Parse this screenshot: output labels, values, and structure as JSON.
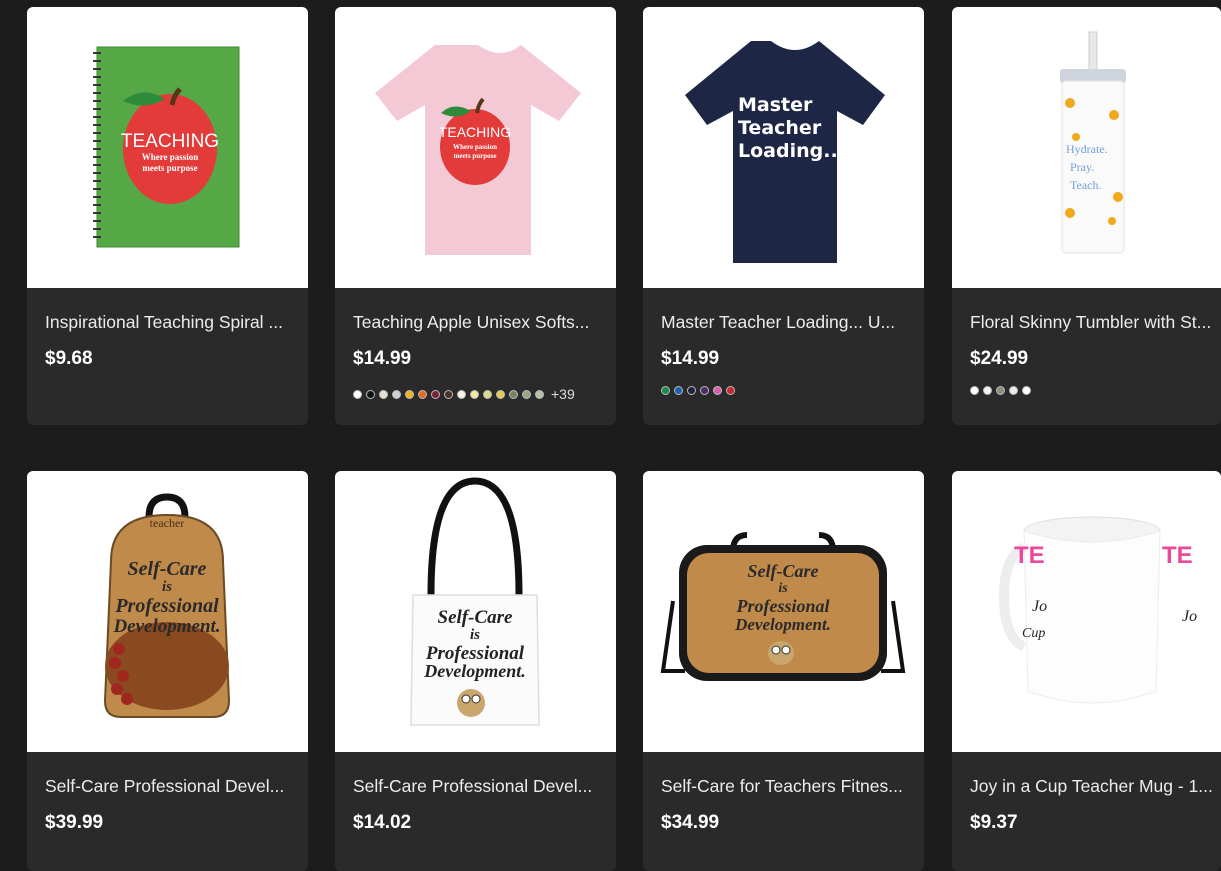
{
  "products": [
    {
      "title": "Inspirational Teaching Spiral ...",
      "price": "$9.68",
      "swatches": [],
      "more": ""
    },
    {
      "title": "Teaching Apple Unisex Softs...",
      "price": "$14.99",
      "swatches": [
        "#ffffff",
        "#111111",
        "#e9e1cf",
        "#cfcfcf",
        "#f3b21b",
        "#e36a21",
        "#7a2436",
        "#4a3428",
        "#fbf5e8",
        "#f4e89b",
        "#d9d98c",
        "#e6c94a",
        "#75845f",
        "#9aa587",
        "#b7c1a8"
      ],
      "more": "+39"
    },
    {
      "title": "Master Teacher Loading... U...",
      "price": "$14.99",
      "swatches": [
        "#1b8a4a",
        "#1e5fb3",
        "#1d2544",
        "#4a2a6b",
        "#d85fb0",
        "#c8272d"
      ],
      "more": ""
    },
    {
      "title": "Floral Skinny Tumbler with St...",
      "price": "$24.99",
      "swatches": [
        "#ffffff",
        "#f4f4f4",
        "#8b8f78",
        "#ececec",
        "#ffffff"
      ],
      "more": ""
    },
    {
      "title": "Self-Care Professional Devel...",
      "price": "$39.99",
      "swatches": [],
      "more": ""
    },
    {
      "title": "Self-Care Professional Devel...",
      "price": "$14.02",
      "swatches": [],
      "more": ""
    },
    {
      "title": "Self-Care for Teachers Fitnes...",
      "price": "$34.99",
      "swatches": [],
      "more": ""
    },
    {
      "title": "Joy in a Cup Teacher Mug - 1...",
      "price": "$9.37",
      "swatches": [],
      "more": ""
    }
  ],
  "art": {
    "notebook": {
      "word": "TEACHING",
      "line1": "Where passion",
      "line2": "meets purpose"
    },
    "tshirt_apple": {
      "word": "TEACHING",
      "line1": "Where passion",
      "line2": "meets purpose"
    },
    "tshirt_navy": {
      "line1": "Master",
      "line2": "Teacher",
      "line3": "Loading..."
    },
    "tumbler": {
      "line1": "Hydrate.",
      "line2": "Pray.",
      "line3": "Teach."
    },
    "backpack": {
      "top": "teacher",
      "line1": "Self-Care",
      "line2": "is",
      "line3": "Professional",
      "line4": "Development."
    },
    "tote": {
      "line1": "Self-Care",
      "line2": "is",
      "line3": "Professional",
      "line4": "Development."
    },
    "duffel": {
      "line1": "Self-Care",
      "line2": "is",
      "line3": "Professional",
      "line4": "Development."
    },
    "mug": {
      "line1": "TE",
      "line2": "Jo",
      "line3": "Cup"
    }
  },
  "colors": {
    "page_bg": "#1c1c1c",
    "card_bg": "#2a2a2a",
    "text": "#ececec",
    "apple_red": "#e23b3a",
    "leaf_green": "#2e8b3a",
    "notebook_green": "#55a845",
    "pink_tee": "#f4c9d6",
    "navy_tee": "#1e2646",
    "bag_tan": "#c08a4a"
  }
}
